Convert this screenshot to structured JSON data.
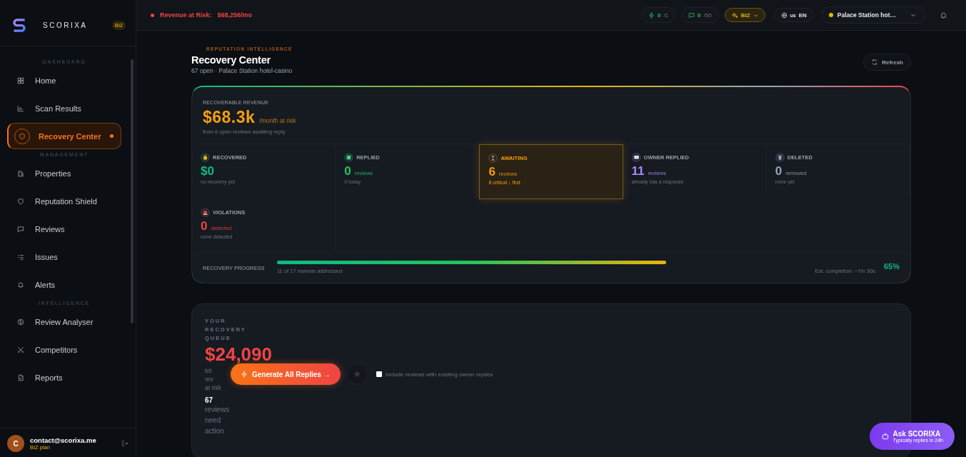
{
  "sidebar": {
    "brand": "SCORIXA",
    "plan_badge": "BIZ",
    "sections": [
      {
        "title": "DASHBOARD",
        "items": [
          {
            "label": "Home",
            "kind": "grid",
            "selected": false,
            "dot": false
          },
          {
            "label": "Scan Results",
            "kind": "chart",
            "selected": false,
            "dot": false
          },
          {
            "label": "Recovery Center",
            "kind": "shield",
            "selected": true,
            "dot": true
          }
        ]
      },
      {
        "title": "MANAGEMENT",
        "items": [
          {
            "label": "Properties",
            "kind": "building",
            "selected": false,
            "dot": false
          },
          {
            "label": "Reputation Shield",
            "kind": "shield",
            "selected": false,
            "dot": false
          },
          {
            "label": "Reviews",
            "kind": "chat",
            "selected": false,
            "dot": false
          },
          {
            "label": "Issues",
            "kind": "list",
            "selected": false,
            "dot": false
          },
          {
            "label": "Alerts",
            "kind": "bell",
            "selected": false,
            "dot": false
          }
        ]
      },
      {
        "title": "INTELLIGENCE",
        "items": [
          {
            "label": "Review Analyser",
            "kind": "brain",
            "selected": false,
            "dot": false
          },
          {
            "label": "Competitors",
            "kind": "swords",
            "selected": false,
            "dot": false
          },
          {
            "label": "Reports",
            "kind": "file",
            "selected": false,
            "dot": false
          }
        ]
      }
    ],
    "user": {
      "initial": "C",
      "email": "contact@scorixa.me",
      "plan": "BIZ plan"
    }
  },
  "topbar": {
    "alert_label": "Revenue at Risk:",
    "alert_value": "$68,256/mo",
    "credits": {
      "value": "0",
      "limit": "/1"
    },
    "messages": {
      "value": "0",
      "limit": "/50"
    },
    "plan": "BIZ",
    "region": "us",
    "language": "EN",
    "property": "Palace Station hot…"
  },
  "header": {
    "eyebrow": "REPUTATION INTELLIGENCE",
    "title": "Recovery Center",
    "subtitle": "67 open · Palace Station hotel-casino",
    "refresh": "Refresh"
  },
  "summary": {
    "label": "RECOVERABLE REVENUE",
    "amount": "$68.3k",
    "amount_suffix": "/month at risk",
    "note": "from 6 open reviews awaiting reply",
    "stats": [
      {
        "kind": "money",
        "title": "RECOVERED",
        "value": "$0",
        "note": "no recovery yet",
        "color": "#10b981",
        "highlighted": false
      },
      {
        "kind": "check",
        "title": "REPLIED",
        "value": "0",
        "unit": "reviews",
        "note": "0 today",
        "color": "#22c55e",
        "highlighted": false
      },
      {
        "kind": "hourglass",
        "title": "AWAITING",
        "value": "6",
        "unit": "reviews",
        "note": "8 critical ↓ first",
        "color": "#f59e0b",
        "highlighted": true
      },
      {
        "kind": "message",
        "title": "OWNER REPLIED",
        "value": "11",
        "unit": "reviews",
        "note": "already has a response",
        "color": "#a78bfa",
        "highlighted": false
      },
      {
        "kind": "trash",
        "title": "DELETED",
        "value": "0",
        "unit": "removed",
        "note": "none yet",
        "color": "#94a3b8",
        "highlighted": false
      },
      {
        "kind": "alarm",
        "title": "VIOLATIONS",
        "value": "0",
        "unit": "detected",
        "note": "none detected",
        "color": "#ef4444",
        "highlighted": false
      }
    ],
    "progress": {
      "label": "RECOVERY PROGRESS",
      "level": 0.65,
      "caption": "11 of 17 reviews addressed",
      "estimate": "Est. completion: ~7m 30s",
      "percent": "65%"
    }
  },
  "queue": {
    "label": "YOUR RECOVERY QUEUE",
    "amount": "$24,090",
    "amount_label_lines": [
      "tot",
      "rev",
      "at risk"
    ],
    "count": "67",
    "count_label": "reviews need action",
    "generate_button": "Generate All Replies →",
    "include_owner_replies": {
      "label": "Include reviews with existing owner replies",
      "checked": false
    }
  },
  "chat_widget": {
    "title": "Ask SCORIXA",
    "subtitle": "Typically replies in 24h"
  }
}
